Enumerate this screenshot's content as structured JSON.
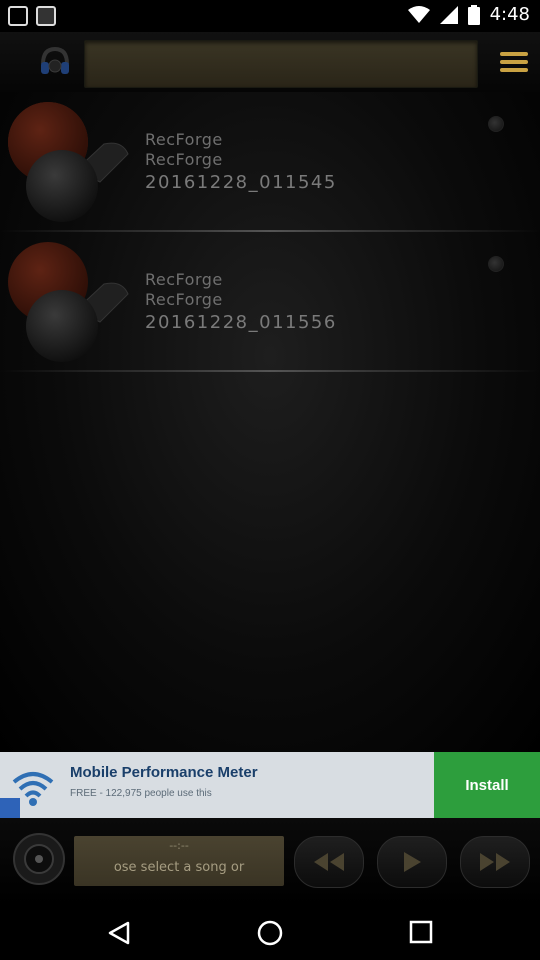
{
  "status_bar": {
    "time": "4:48"
  },
  "toolbar": {
    "search_placeholder": ""
  },
  "recordings": [
    {
      "title": "RecForge",
      "artist": "RecForge",
      "name": "20161228_011545"
    },
    {
      "title": "RecForge",
      "artist": "RecForge",
      "name": "20161228_011556"
    }
  ],
  "ad": {
    "title": "Mobile Performance Meter",
    "subtitle": "FREE - 122,975 people use this",
    "install_label": "Install"
  },
  "player": {
    "time": "--:--",
    "status_text": "ose select a song or"
  },
  "colors": {
    "accent": "#c9a243",
    "install": "#2d9e3d",
    "ad_background": "#d8dde2"
  }
}
